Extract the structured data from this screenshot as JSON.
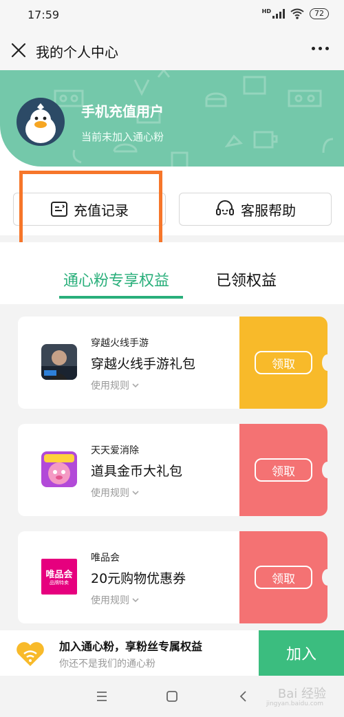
{
  "status_bar": {
    "time": "17:59",
    "network": "HD",
    "battery": "72"
  },
  "title_bar": {
    "title": "我的个人中心"
  },
  "profile": {
    "name": "手机充值用户",
    "status": "当前未加入通心粉",
    "header_color": "#74c8aa"
  },
  "actions": {
    "recharge_label": "充值记录",
    "service_label": "客服帮助"
  },
  "tabs": [
    {
      "label": "通心粉专享权益",
      "active": true
    },
    {
      "label": "已领权益",
      "active": false
    }
  ],
  "coupons": [
    {
      "app": "穿越火线手游",
      "gift": "穿越火线手游礼包",
      "rules": "使用规则",
      "claim": "领取",
      "color": "#f8ba2a",
      "icon": "cf-game-icon"
    },
    {
      "app": "天天爱消除",
      "gift": "道具金币大礼包",
      "rules": "使用规则",
      "claim": "领取",
      "color": "#f47273",
      "icon": "ttaxc-game-icon"
    },
    {
      "app": "唯品会",
      "gift": "20元购物优惠券",
      "rules": "使用规则",
      "claim": "领取",
      "color": "#f47273",
      "icon": "vip-shop-icon",
      "icon_text": "唯品会",
      "icon_subtext": "品牌特卖"
    }
  ],
  "join_bar": {
    "title": "加入通心粉，享粉丝专属权益",
    "subtitle": "你还不是我们的通心粉",
    "button": "加入"
  },
  "watermark": {
    "text": "Bai 经验",
    "sub": "jingyan.baidu.com"
  },
  "colors": {
    "accent": "#2aaf7b",
    "join_button": "#3bbd7f",
    "highlight": "#f6762a"
  }
}
